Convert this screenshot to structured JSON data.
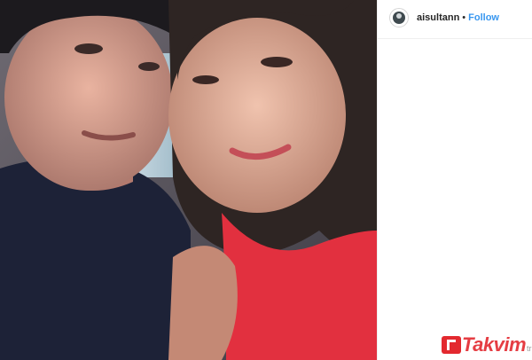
{
  "post": {
    "username": "aisultann",
    "separator": "•",
    "follow_label": "Follow"
  },
  "photo": {
    "description_icon": "selfie-photo"
  },
  "watermark": {
    "brand": "Takvim",
    "suffix": "tr",
    "color": "#e3292f"
  },
  "colors": {
    "follow": "#3897f0",
    "text": "#262626",
    "border": "#efefef"
  }
}
